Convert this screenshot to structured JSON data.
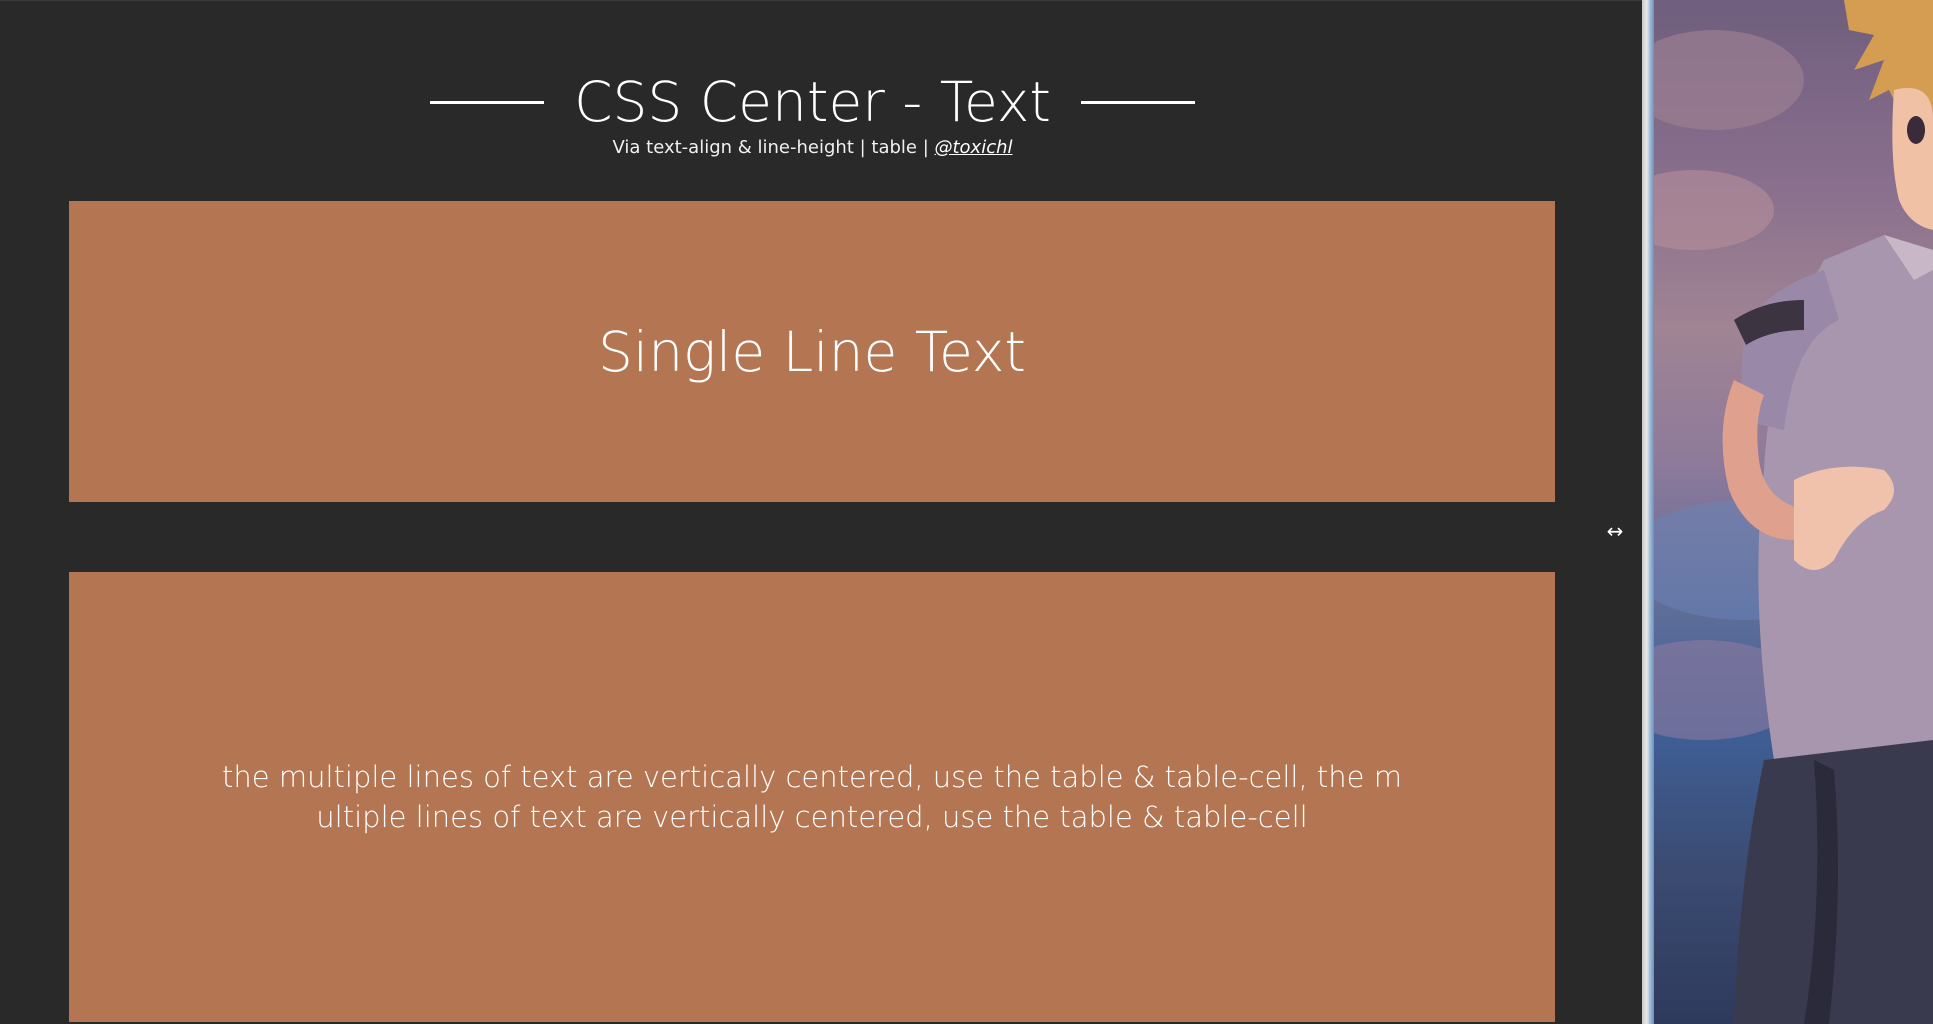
{
  "header": {
    "title": "CSS Center - Text",
    "subtitle_prefix": "Via text-align & line-height | table | ",
    "subtitle_handle": "@toxichl"
  },
  "boxes": {
    "single_line": "Single Line Text",
    "multi_line": "the multiple lines of text are vertically centered, use the table & table-cell, the multiple lines of text are vertically centered, use the table & table-cell"
  },
  "colors": {
    "background": "#292929",
    "box": "#b37552",
    "text": "#ffffff"
  },
  "icons": {
    "resize_cursor": "horizontal-resize-icon",
    "divider": "pane-splitter"
  }
}
